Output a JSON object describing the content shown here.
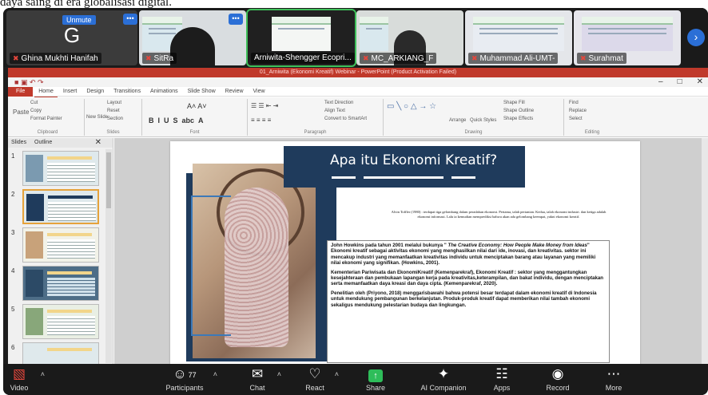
{
  "caption": "daya saing di era globalisasi digital.",
  "participants_strip": {
    "tiles": [
      {
        "name": "Ghina Mukhti Hanifah",
        "unmute": "Unmute",
        "avatar": "G",
        "muted": true
      },
      {
        "name": "SitRa",
        "muted": true
      },
      {
        "name": "Arniwita-Shengger Ecopri...",
        "muted": false
      },
      {
        "name": "MC_ARKIANG_F",
        "muted": true
      },
      {
        "name": "Muhammad Ali-UMT-",
        "muted": true
      },
      {
        "name": "Surahmat",
        "muted": true
      }
    ],
    "next_icon": "chevron-right-icon"
  },
  "powerpoint": {
    "title": "01_Arniwita (Ekonomi Kreatif) Webinar - PowerPoint (Product Activation Failed)",
    "tabs": [
      "Home",
      "Insert",
      "Design",
      "Transitions",
      "Animations",
      "Slide Show",
      "Review",
      "View"
    ],
    "file_tab": "File",
    "ribbon_groups": {
      "clipboard": "Clipboard",
      "slides": "Slides",
      "font": "Font",
      "paragraph": "Paragraph",
      "drawing": "Drawing",
      "editing": "Editing"
    },
    "ribbon_items": {
      "cut": "Cut",
      "copy": "Copy",
      "paste": "Paste",
      "format_painter": "Format Painter",
      "layout": "Layout",
      "reset": "Reset",
      "new_slide": "New Slide",
      "section": "Section",
      "text_direction": "Text Direction",
      "align_text": "Align Text",
      "convert_smartart": "Convert to SmartArt",
      "arrange": "Arrange",
      "quick_styles": "Quick Styles",
      "shape_fill": "Shape Fill",
      "shape_outline": "Shape Outline",
      "shape_effects": "Shape Effects",
      "find": "Find",
      "replace": "Replace",
      "select": "Select"
    },
    "panel_tabs": [
      "Slides",
      "Outline"
    ],
    "slide_numbers": [
      "1",
      "2",
      "3",
      "4",
      "5",
      "6"
    ],
    "selected_slide": 2,
    "slide": {
      "heading": "Apa itu Ekonomi Kreatif?",
      "quote": "Alvin Toffler (1980) : terdapat tiga gelombang dalam peradaban ekonomi. Pertama, ialah pertanian. Kedua, ialah ekonomi industri. dan ketiga adalah ekonomi informasi. Lalu ia kemudian memprediksi bahwa akan ada gelombang keempat, yakni ekonomi kreatif.",
      "para1_a": "John Howkins pada tahun 2001 melalui bukunya \" ",
      "para1_book": "The Creative Economy: How People Make Money from Ideas",
      "para1_b": "\" Ekonomi kreatif sebagai aktivitas ekonomi yang menghasilkan nilai dari ide, inovasi, dan kreativitas. sektor ini mencakup industri yang memanfaatkan kreativitas individu untuk menciptakan barang atau layanan yang memiliki nilai ekonomi yang signifikan. (Howkins, 2001).",
      "para2": "Kementerian Pariwisata dan EkonomiKreatif (Kemenparekraf), Ekonomi Kreatif : sektor yang menggantungkan kesejahteraan dan pembukaan lapangan kerja pada kreativitas,keterampilan, dan bakat individu, dengan menciptakan serta memanfaatkan daya kreasi dan daya cipta. (Kemenparekraf, 2020).",
      "para3": "Penelitian oleh (Priyono, 2018) menggarisbawahi bahwa potensi besar terdapat dalam ekonomi kreatif di Indonesia untuk mendukung pembangunan berkelanjutan. Produk-produk kreatif dapat memberikan nilai tambah ekonomi sekaligus mendukung pelestarian budaya dan lingkungan."
    }
  },
  "toolbar": {
    "video": "Video",
    "participants": "Participants",
    "participants_count": "77",
    "chat": "Chat",
    "react": "React",
    "share": "Share",
    "ai_companion": "AI Companion",
    "apps": "Apps",
    "record": "Record",
    "more": "More"
  },
  "colors": {
    "accent": "#2b6fd6",
    "share_green": "#2ebd5a",
    "ppt_red": "#c0392b",
    "slide_navy": "#1f3b5c",
    "muted_red": "#e5473d"
  }
}
